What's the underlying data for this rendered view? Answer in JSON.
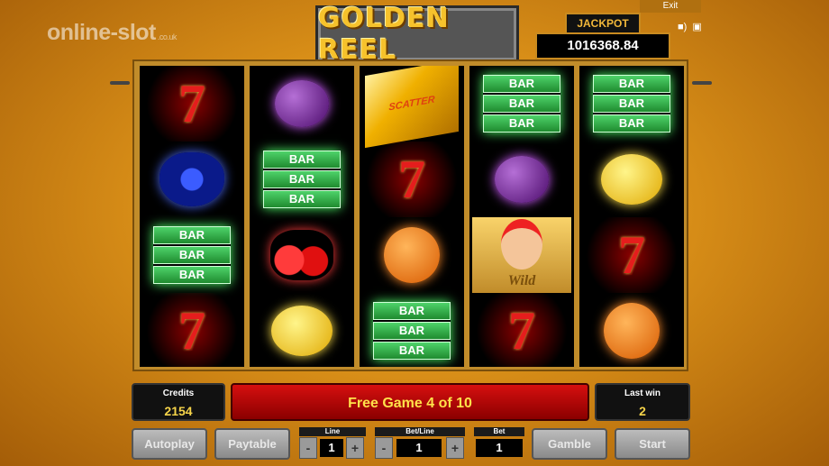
{
  "watermark": {
    "brand": "online-slot",
    "suffix": ".co.uk"
  },
  "game_title": "GOLDEN REEL",
  "top_bar": {
    "exit_label": "Exit",
    "icons": [
      "sound-icon",
      "fullscreen-icon"
    ]
  },
  "jackpot": {
    "label": "JACKPOT",
    "value": "1016368.84"
  },
  "reels": [
    [
      {
        "type": "seven",
        "label": "7"
      },
      {
        "type": "grapes"
      },
      {
        "type": "bar",
        "label": "BAR"
      },
      {
        "type": "seven",
        "label": "7"
      }
    ],
    [
      {
        "type": "plum"
      },
      {
        "type": "bar",
        "label": "BAR"
      },
      {
        "type": "cherry"
      },
      {
        "type": "lemon"
      }
    ],
    [
      {
        "type": "scatter",
        "label": "SCATTER"
      },
      {
        "type": "seven",
        "label": "7"
      },
      {
        "type": "orange"
      },
      {
        "type": "bar",
        "label": "BAR"
      }
    ],
    [
      {
        "type": "bar",
        "label": "BAR"
      },
      {
        "type": "plum"
      },
      {
        "type": "wild",
        "label": "Wild"
      },
      {
        "type": "seven",
        "label": "7"
      }
    ],
    [
      {
        "type": "bar",
        "label": "BAR"
      },
      {
        "type": "lemon"
      },
      {
        "type": "seven",
        "label": "7"
      },
      {
        "type": "orange"
      }
    ]
  ],
  "credits": {
    "label": "Credits",
    "value": "2154"
  },
  "message": "Free Game 4 of 10",
  "last_win": {
    "label": "Last win",
    "value": "2"
  },
  "buttons": {
    "autoplay": "Autoplay",
    "paytable": "Paytable",
    "gamble": "Gamble",
    "start": "Start"
  },
  "line": {
    "label": "Line",
    "value": "1"
  },
  "bet_line": {
    "label": "Bet/Line",
    "value": "1"
  },
  "bet": {
    "label": "Bet",
    "value": "1"
  },
  "stepper": {
    "minus": "-",
    "plus": "+"
  }
}
